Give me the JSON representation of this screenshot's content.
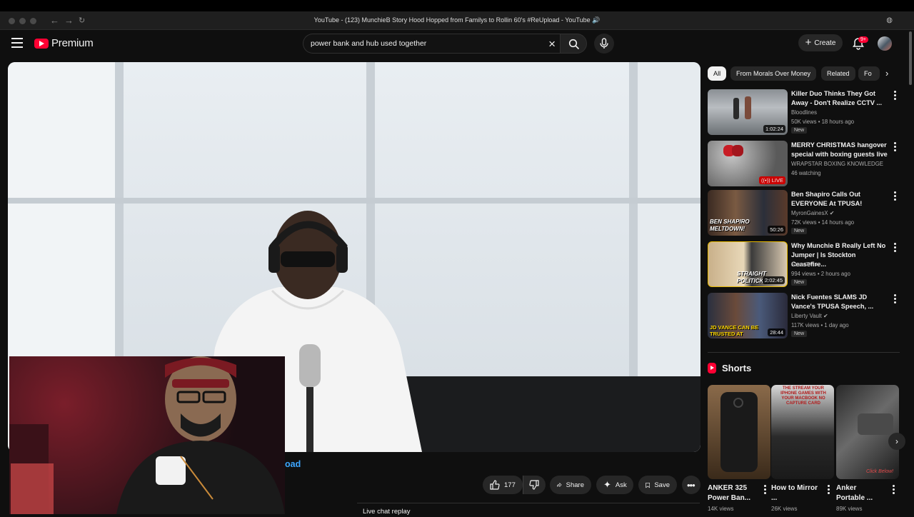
{
  "window": {
    "title": "YouTube - (123) MunchieB Story Hood Hopped from Familys to Rollin 60's #ReUpload - YouTube 🔊"
  },
  "header": {
    "logo_text": "Premium",
    "search_value": "power bank and hub used together",
    "create_label": "Create",
    "notifications_badge": "9+"
  },
  "video": {
    "title_fragment": "oad",
    "actions": {
      "like_count": "177",
      "share_label": "Share",
      "ask_label": "Ask",
      "save_label": "Save"
    },
    "live_chat_label": "Live chat replay"
  },
  "chips": [
    {
      "label": "All",
      "active": true
    },
    {
      "label": "From Morals Over Money"
    },
    {
      "label": "Related"
    },
    {
      "label": "Fo"
    }
  ],
  "recommendations": [
    {
      "title": "Killer Duo Thinks They Got Away - Don't Realize CCTV ...",
      "channel": "Bloodlines",
      "meta": "50K views • 18 hours ago",
      "duration": "1:02:24",
      "badge": "New"
    },
    {
      "title": "MERRY CHRISTMAS hangover special with boxing guests live",
      "channel": "WRAPSTAR BOXING KNOWLEDGE",
      "meta": "46 watching",
      "live_label": "LIVE"
    },
    {
      "title": "Ben Shapiro Calls Out EVERYONE At TPUSA!",
      "channel": "MyronGainesX",
      "verified": true,
      "meta": "72K views • 14 hours ago",
      "duration": "50:26",
      "badge": "New",
      "thumb_text": "BEN SHAPIRO MELTDOWN!"
    },
    {
      "title": "Why Munchie B Really Left No Jumper | Is Stockton Ceasefire...",
      "channel": "StreetTV",
      "verified": true,
      "meta": "994 views • 2 hours ago",
      "duration": "2:02:45",
      "badge": "New",
      "thumb_text": "STRAIGHT POLITICKIN"
    },
    {
      "title": "Nick Fuentes SLAMS JD Vance's TPUSA Speech, ...",
      "channel": "Liberty Vault",
      "verified": true,
      "meta": "117K views • 1 day ago",
      "duration": "28:44",
      "badge": "New",
      "thumb_text": "JD VANCE CAN BE TRUSTED AT"
    }
  ],
  "shorts": {
    "heading": "Shorts",
    "items": [
      {
        "title": "ANKER 325 Power Ban...",
        "views": "14K views"
      },
      {
        "title": "How to Mirror ...",
        "views": "26K views",
        "thumb_text": "THE STREAM YOUR IPHONE GAMES WITH YOUR MACBOOK NO CAPTURE CARD"
      },
      {
        "title": "Anker Portable ...",
        "views": "89K views",
        "thumb_text": "Click Below!"
      }
    ]
  },
  "colors": {
    "accent": "#ff0033",
    "link": "#3ea6ff",
    "background": "#0f0f0f"
  }
}
